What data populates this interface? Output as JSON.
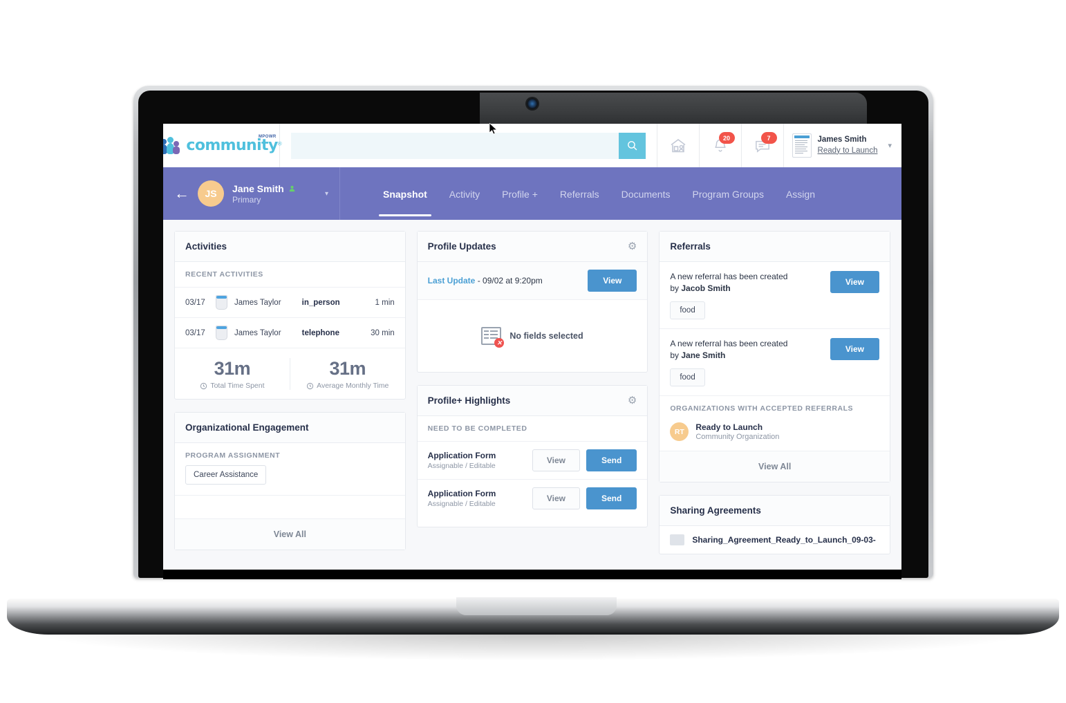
{
  "app": {
    "logo_word": "community",
    "logo_super": "MPOWR",
    "logo_tm": "®"
  },
  "header": {
    "search_value": "",
    "search_placeholder": "",
    "search_icon": "search-icon",
    "home_icon": "home-with-person-icon",
    "bell_icon": "bell-icon",
    "bell_badge": "20",
    "chat_icon": "chat-bubble-icon",
    "chat_badge": "7",
    "user_name": "James Smith",
    "user_org": "Ready to Launch",
    "user_caret": "⌄"
  },
  "client_bar": {
    "back_arrow": "←",
    "avatar_initials": "JS",
    "name": "Jane Smith",
    "role": "Primary",
    "person_icon": "person-icon",
    "caret": "▾",
    "tabs": [
      {
        "label": "Snapshot",
        "active": true
      },
      {
        "label": "Activity",
        "active": false
      },
      {
        "label": "Profile +",
        "active": false
      },
      {
        "label": "Referrals",
        "active": false
      },
      {
        "label": "Documents",
        "active": false
      },
      {
        "label": "Program Groups",
        "active": false
      },
      {
        "label": "Assign",
        "active": false
      }
    ]
  },
  "activities": {
    "title": "Activities",
    "section_label": "RECENT ACTIVITIES",
    "columns": [
      "date",
      "icon",
      "name",
      "type",
      "duration"
    ],
    "rows": [
      {
        "date": "03/17",
        "name": "James Taylor",
        "type": "in_person",
        "duration": "1 min"
      },
      {
        "date": "03/17",
        "name": "James Taylor",
        "type": "telephone",
        "duration": "30 min"
      }
    ],
    "stats": [
      {
        "value": "31m",
        "label": "Total Time Spent",
        "icon": "clock-icon"
      },
      {
        "value": "31m",
        "label": "Average Monthly Time",
        "icon": "clock-icon"
      }
    ]
  },
  "org_engagement": {
    "title": "Organizational Engagement",
    "section_label": "PROGRAM ASSIGNMENT",
    "program": "Career Assistance",
    "view_all": "View All"
  },
  "profile_updates": {
    "title": "Profile Updates",
    "gear_icon": "gear-icon",
    "last_update_label": "Last Update",
    "last_update_value": " - 09/02 at 9:20pm",
    "view_button": "View",
    "empty_text": "No fields selected",
    "empty_icon": "document-error-icon"
  },
  "profile_highlights": {
    "title": "Profile+ Highlights",
    "gear_icon": "gear-icon",
    "section_label": "NEED TO BE COMPLETED",
    "rows": [
      {
        "name": "Application Form",
        "sub": "Assignable / Editable",
        "view": "View",
        "send": "Send"
      },
      {
        "name": "Application Form",
        "sub": "Assignable / Editable",
        "view": "View",
        "send": "Send"
      }
    ]
  },
  "referrals": {
    "title": "Referrals",
    "items": [
      {
        "text": "A new referral has been created",
        "by_prefix": "by ",
        "by": "Jacob Smith",
        "tag": "food",
        "view": "View"
      },
      {
        "text": "A new referral has been created",
        "by_prefix": "by ",
        "by": "Jane Smith",
        "tag": "food",
        "view": "View"
      }
    ],
    "orgs_label": "ORGANIZATIONS WITH ACCEPTED REFERRALS",
    "org": {
      "initials": "RT",
      "name": "Ready to Launch",
      "sub": "Community Organization"
    },
    "view_all": "View All"
  },
  "sharing_agreements": {
    "title": "Sharing Agreements",
    "items": [
      {
        "name": "Sharing_Agreement_Ready_to_Launch_09-03-",
        "icon": "file-icon"
      }
    ]
  },
  "colors": {
    "brand_teal": "#63c4de",
    "nav_purple": "#6e74bf",
    "action_blue": "#4a94ce",
    "badge_red": "#f2544a",
    "avatar_peach": "#f7cb8e",
    "page_bg": "#f7f8fa"
  }
}
